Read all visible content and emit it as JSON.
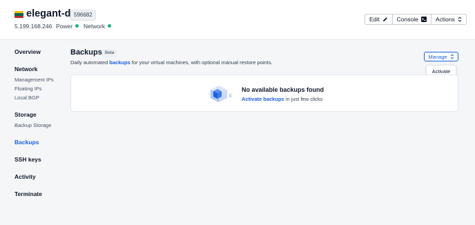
{
  "header": {
    "vm_name": "elegant-doe",
    "vm_id": "596682",
    "ip": "5.199.168.246",
    "power_label": "Power",
    "network_label": "Network",
    "status_color": "#10b981",
    "flag_colors": [
      "#fdb913",
      "#006a44",
      "#c1272d"
    ],
    "actions": {
      "edit_label": "Edit",
      "console_label": "Console",
      "actions_label": "Actions"
    }
  },
  "sidebar": {
    "overview": "Overview",
    "network": {
      "title": "Network",
      "items": [
        "Management IPs",
        "Floating IPs",
        "Local BGP"
      ]
    },
    "storage": {
      "title": "Storage",
      "items": [
        "Backup Storage"
      ]
    },
    "backups": "Backups",
    "ssh_keys": "SSH keys",
    "activity": "Activity",
    "terminate": "Terminate"
  },
  "main": {
    "title": "Backups",
    "badge": "Beta",
    "description": {
      "before": "Daily automated ",
      "link": "backups",
      "after": " for your virtual machines, with optional manual restore points."
    },
    "manage_label": "Manage",
    "dropdown_items": [
      "Activate"
    ],
    "empty": {
      "title": "No available backups found",
      "link": "Activate backups",
      "after": " in just few clicks"
    }
  },
  "colors": {
    "accent": "#1d5fe0",
    "background": "#f5f6f8"
  }
}
